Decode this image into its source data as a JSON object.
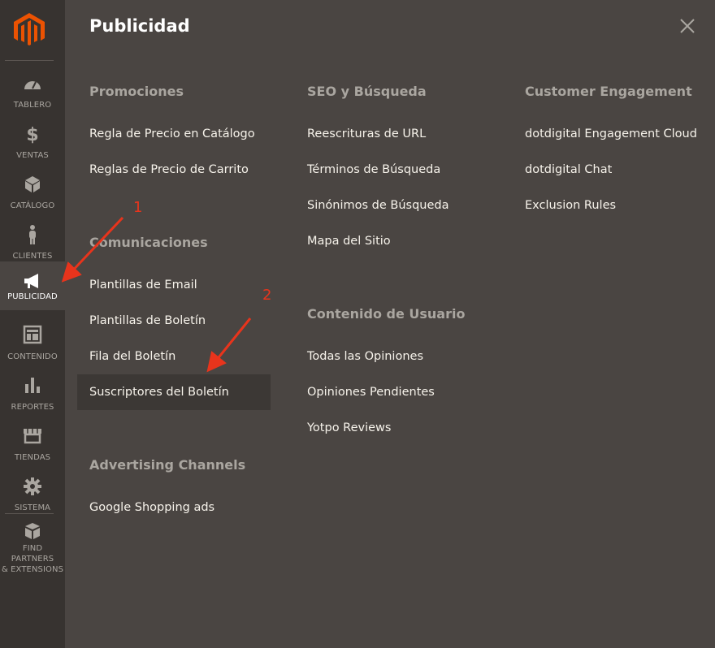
{
  "colors": {
    "sidebar": "#373330",
    "panel": "#4a4542",
    "accent": "#eb5202",
    "annotation": "#e8341c"
  },
  "sidebar": {
    "logo_icon": "magento-logo-icon",
    "items": [
      {
        "label": "TABLERO",
        "icon": "dashboard-icon"
      },
      {
        "label": "VENTAS",
        "icon": "dollar-icon"
      },
      {
        "label": "CATÁLOGO",
        "icon": "cube-icon"
      },
      {
        "label": "CLIENTES",
        "icon": "person-icon"
      },
      {
        "label": "PUBLICIDAD",
        "icon": "megaphone-icon",
        "active": true
      },
      {
        "label": "CONTENIDO",
        "icon": "layout-icon"
      },
      {
        "label": "REPORTES",
        "icon": "bar-chart-icon"
      },
      {
        "label": "TIENDAS",
        "icon": "store-icon"
      },
      {
        "label": "SISTEMA",
        "icon": "gear-icon"
      },
      {
        "label_line1": "FIND PARTNERS",
        "label_line2": "& EXTENSIONS",
        "icon": "blocks-icon"
      }
    ]
  },
  "panel": {
    "title": "Publicidad",
    "close_icon": "close-icon",
    "columns": [
      {
        "sections": [
          {
            "heading": "Promociones",
            "links": [
              "Regla de Precio en Catálogo",
              "Reglas de Precio de Carrito"
            ]
          },
          {
            "heading": "Comunicaciones",
            "links": [
              "Plantillas de Email",
              "Plantillas de Boletín",
              "Fila del Boletín",
              "Suscriptores del Boletín"
            ]
          },
          {
            "heading": "Advertising Channels",
            "links": [
              "Google Shopping ads"
            ]
          }
        ]
      },
      {
        "sections": [
          {
            "heading": "SEO y Búsqueda",
            "links": [
              "Reescrituras de URL",
              "Términos de Búsqueda",
              "Sinónimos de Búsqueda",
              "Mapa del Sitio"
            ]
          },
          {
            "heading": "Contenido de Usuario",
            "links": [
              "Todas las Opiniones",
              "Opiniones Pendientes",
              "Yotpo Reviews"
            ]
          }
        ]
      },
      {
        "sections": [
          {
            "heading": "Customer Engagement",
            "links": [
              "dotdigital Engagement Cloud",
              "dotdigital Chat",
              "Exclusion Rules"
            ]
          }
        ]
      }
    ],
    "highlighted_link": "Suscriptores del Boletín"
  },
  "annotations": {
    "step1": "1",
    "step2": "2"
  }
}
